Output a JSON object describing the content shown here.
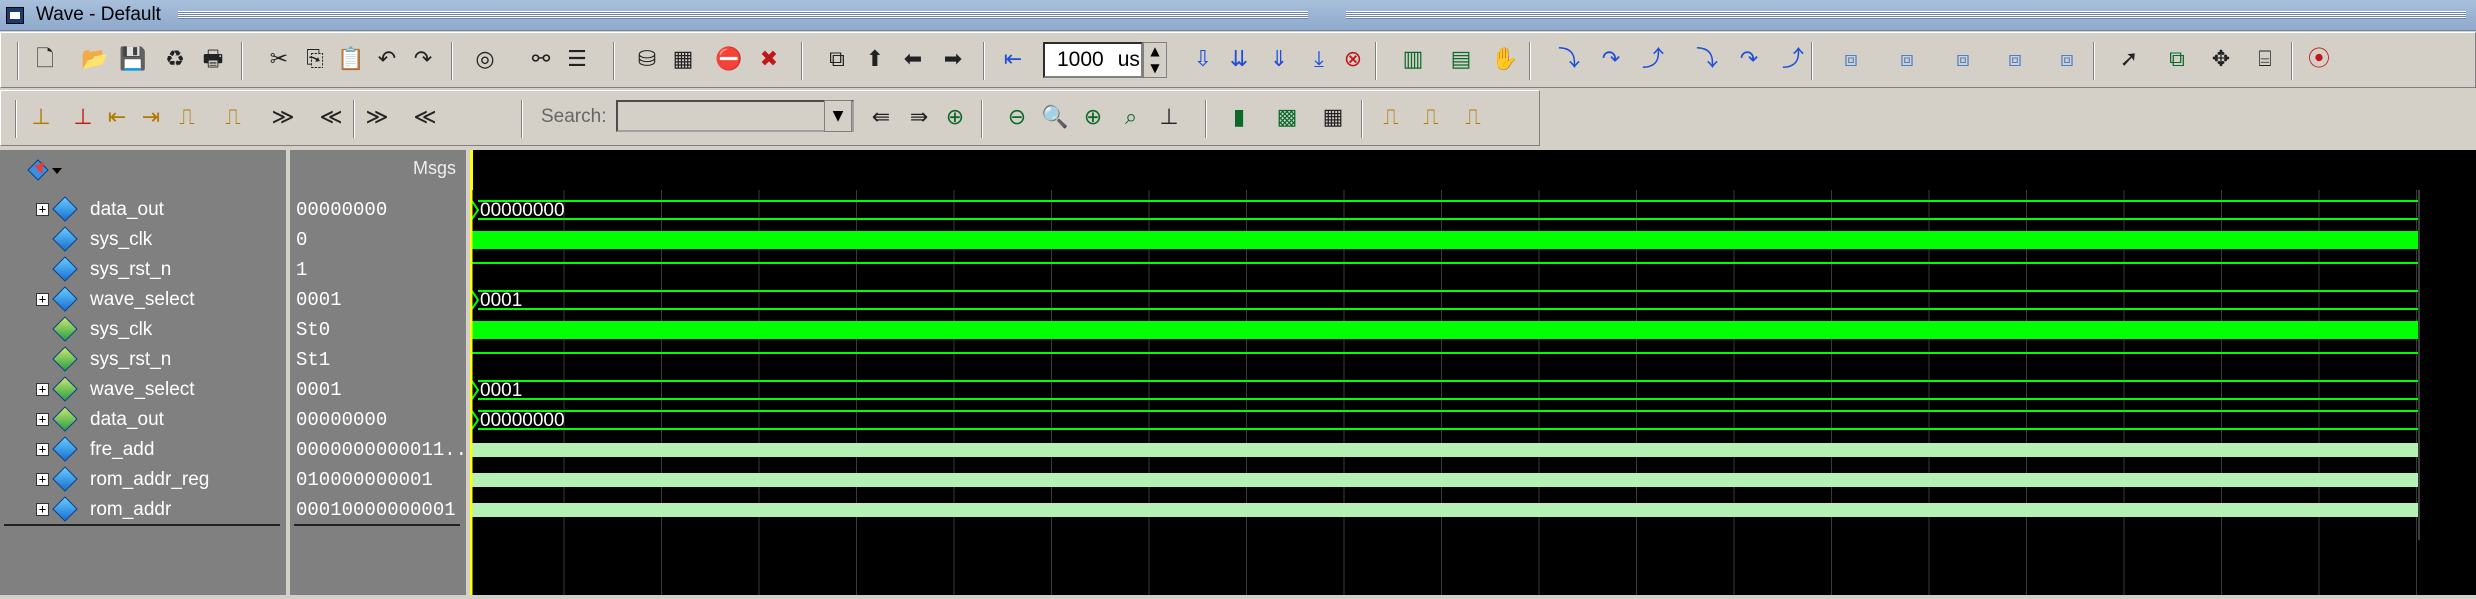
{
  "window": {
    "title": "Wave - Default"
  },
  "toolbar": {
    "time_value": "1000",
    "time_unit": "us",
    "search_label": "Search:",
    "search_value": ""
  },
  "panes": {
    "name_header_icon": "cursor-menu-icon",
    "msgs_header": "Msgs"
  },
  "signals": [
    {
      "name": "data_out",
      "value": "00000000",
      "expandable": true,
      "kind": "bus",
      "wave": "bus",
      "label": "00000000"
    },
    {
      "name": "sys_clk",
      "value": "0",
      "expandable": false,
      "kind": "bit",
      "wave": "clk",
      "label": ""
    },
    {
      "name": "sys_rst_n",
      "value": "1",
      "expandable": false,
      "kind": "bit",
      "wave": "high",
      "label": ""
    },
    {
      "name": "wave_select",
      "value": "0001",
      "expandable": true,
      "kind": "bus",
      "wave": "bus",
      "label": "0001"
    },
    {
      "name": "sys_clk",
      "value": "St0",
      "expandable": false,
      "kind": "ext",
      "wave": "clk",
      "label": ""
    },
    {
      "name": "sys_rst_n",
      "value": "St1",
      "expandable": false,
      "kind": "ext",
      "wave": "high",
      "label": ""
    },
    {
      "name": "wave_select",
      "value": "0001",
      "expandable": true,
      "kind": "ext",
      "wave": "bus",
      "label": "0001"
    },
    {
      "name": "data_out",
      "value": "00000000",
      "expandable": true,
      "kind": "ext",
      "wave": "bus",
      "label": "00000000"
    },
    {
      "name": "fre_add",
      "value": "0000000000011...",
      "expandable": true,
      "kind": "bus",
      "wave": "fastbus",
      "label": ""
    },
    {
      "name": "rom_addr_reg",
      "value": "010000000001",
      "expandable": true,
      "kind": "bus",
      "wave": "fastbus",
      "label": ""
    },
    {
      "name": "rom_addr",
      "value": "00010000000001",
      "expandable": true,
      "kind": "bus",
      "wave": "fastbus",
      "label": ""
    }
  ],
  "colors": {
    "wave_green": "#00ff00",
    "wave_light_green": "#b5f0b5",
    "cursor": "#ffff00",
    "grid": "#3a3a3a"
  },
  "icons": {
    "toolbar1": [
      "new-icon",
      "open-icon",
      "save-icon",
      "reload-icon",
      "print-icon",
      "cut-icon",
      "copy-icon",
      "paste-icon",
      "undo-icon",
      "redo-icon",
      "find-icon",
      "binoculars-icon",
      "format-icon",
      "compile-icon",
      "simulate-icon",
      "break-icon",
      "stop-icon",
      "restart-icon",
      "up-icon",
      "back-icon",
      "forward-icon",
      "run-length-icon",
      "run-icon",
      "continue-icon",
      "run-all-icon",
      "step-icon",
      "stop-sim-icon",
      "wave-icon",
      "dataflow-icon",
      "hand-icon",
      "step-into-icon",
      "step-over-icon",
      "step-out-icon",
      "step-into-2-icon",
      "step-over-2-icon",
      "step-out-2-icon",
      "add-wave-icon",
      "add-list-icon",
      "add-log-icon",
      "add-dataflow-icon",
      "add-schematic-icon",
      "select-icon",
      "zoom-region-icon",
      "pan-icon",
      "edit-icon",
      "traffic-light-icon"
    ],
    "toolbar2": [
      "insert-cursor-icon",
      "delete-cursor-icon",
      "prev-edge-icon",
      "next-edge-icon",
      "rise-icon",
      "fall-icon",
      "expand-icon",
      "collapse-icon",
      "search-icon",
      "find-prev-icon",
      "find-next-icon",
      "zoom-in-icon",
      "zoom-out-icon",
      "zoom-full-icon",
      "zoom-cursor-icon",
      "zoom-last-icon",
      "format-literal-icon",
      "format-logic-icon",
      "format-analog-icon",
      "snap-icon",
      "edge-rise-icon",
      "edge-fall-icon",
      "edge-any-icon"
    ]
  }
}
